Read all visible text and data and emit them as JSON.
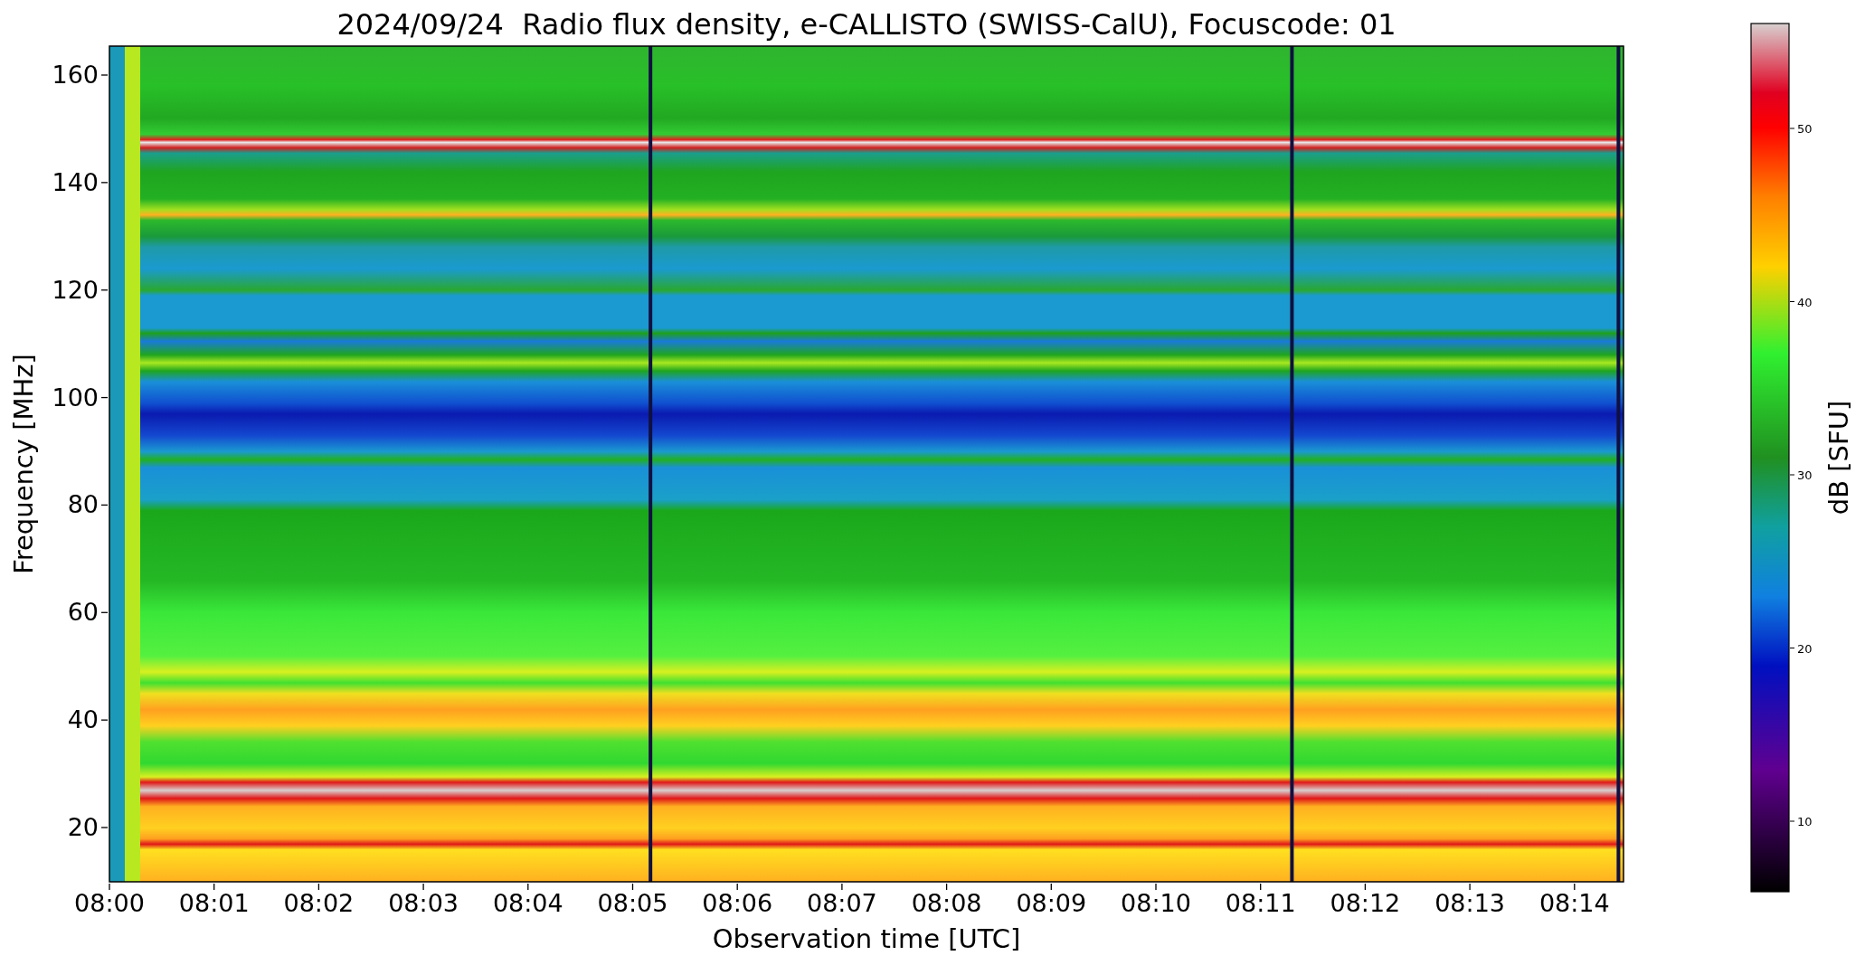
{
  "plot": {
    "title": "2024/09/24  Radio flux density, e-CALLISTO (SWISS-CalU), Focuscode: 01",
    "xlabel": "Observation time [UTC]",
    "ylabel": "Frequency [MHz]",
    "x_tick_labels": [
      "08:00",
      "08:01",
      "08:02",
      "08:03",
      "08:04",
      "08:05",
      "08:06",
      "08:07",
      "08:08",
      "08:09",
      "08:10",
      "08:11",
      "08:12",
      "08:13",
      "08:14"
    ],
    "y_tick_labels": [
      "160",
      "140",
      "120",
      "100",
      "80",
      "60",
      "40",
      "20"
    ]
  },
  "colorbar": {
    "label": "dB [SFU]",
    "tick_labels": [
      "50",
      "40",
      "30",
      "20",
      "10"
    ]
  }
}
